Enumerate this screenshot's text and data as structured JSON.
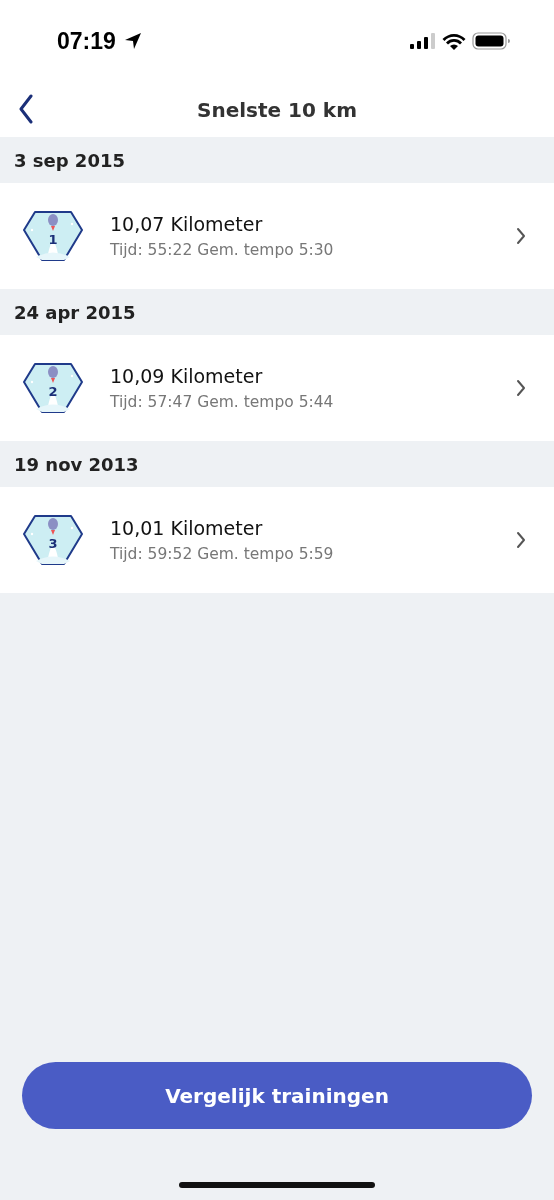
{
  "status_bar": {
    "time": "07:19"
  },
  "nav": {
    "title": "Snelste 10 km"
  },
  "sections": [
    {
      "date": "3 sep 2015",
      "entries": [
        {
          "rank": "1",
          "distance": "10,07 Kilometer",
          "details": "Tijd: 55:22 Gem. tempo 5:30"
        }
      ]
    },
    {
      "date": "24 apr 2015",
      "entries": [
        {
          "rank": "2",
          "distance": "10,09 Kilometer",
          "details": "Tijd: 57:47 Gem. tempo 5:44"
        }
      ]
    },
    {
      "date": "19 nov 2013",
      "entries": [
        {
          "rank": "3",
          "distance": "10,01 Kilometer",
          "details": "Tijd: 59:52 Gem. tempo 5:59"
        }
      ]
    }
  ],
  "compare_button": "Vergelijk trainingen"
}
